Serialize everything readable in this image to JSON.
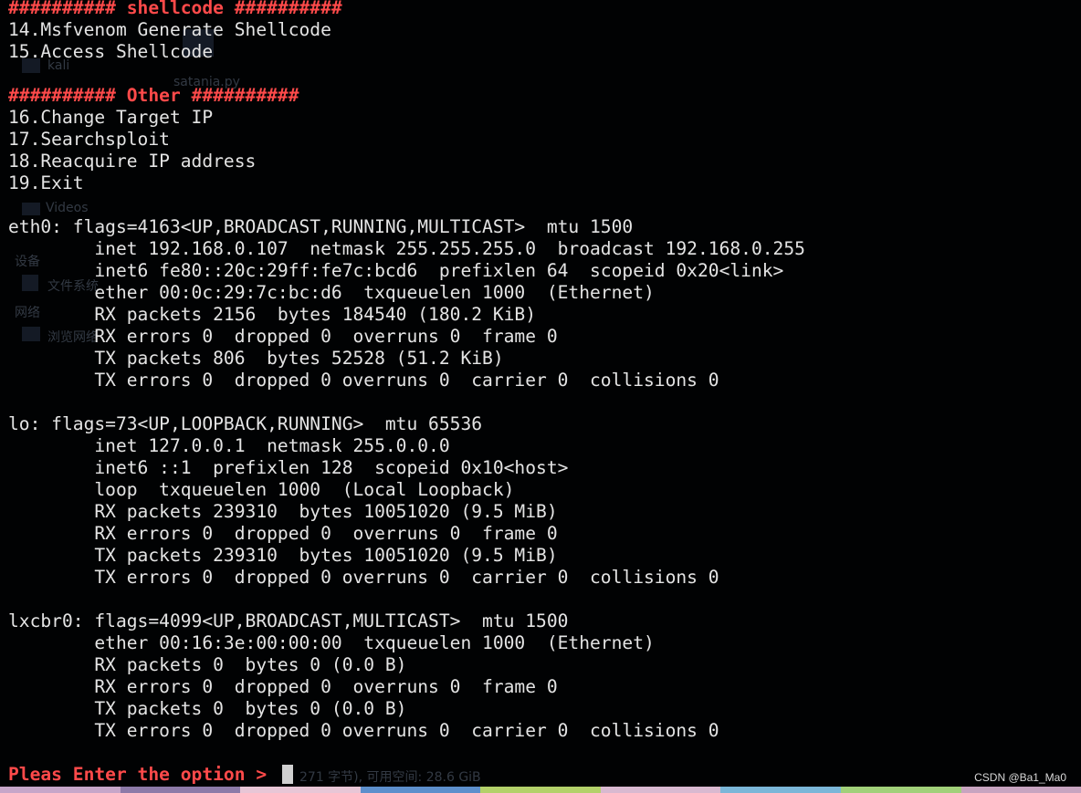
{
  "terminal": {
    "menu": {
      "shellcode_header": "########## shellcode ##########",
      "item_14": "14.Msfvenom Generate Shellcode",
      "item_15": "15.Access Shellcode",
      "other_header": "########## Other ##########",
      "item_16": "16.Change Target IP",
      "item_17": "17.Searchsploit",
      "item_18": "18.Reacquire IP address",
      "item_19": "19.Exit"
    },
    "eth0": {
      "l1": "eth0: flags=4163<UP,BROADCAST,RUNNING,MULTICAST>  mtu 1500",
      "l2": "        inet 192.168.0.107  netmask 255.255.255.0  broadcast 192.168.0.255",
      "l3": "        inet6 fe80::20c:29ff:fe7c:bcd6  prefixlen 64  scopeid 0x20<link>",
      "l4": "        ether 00:0c:29:7c:bc:d6  txqueuelen 1000  (Ethernet)",
      "l5": "        RX packets 2156  bytes 184540 (180.2 KiB)",
      "l6": "        RX errors 0  dropped 0  overruns 0  frame 0",
      "l7": "        TX packets 806  bytes 52528 (51.2 KiB)",
      "l8": "        TX errors 0  dropped 0 overruns 0  carrier 0  collisions 0"
    },
    "lo": {
      "l1": "lo: flags=73<UP,LOOPBACK,RUNNING>  mtu 65536",
      "l2": "        inet 127.0.0.1  netmask 255.0.0.0",
      "l3": "        inet6 ::1  prefixlen 128  scopeid 0x10<host>",
      "l4": "        loop  txqueuelen 1000  (Local Loopback)",
      "l5": "        RX packets 239310  bytes 10051020 (9.5 MiB)",
      "l6": "        RX errors 0  dropped 0  overruns 0  frame 0",
      "l7": "        TX packets 239310  bytes 10051020 (9.5 MiB)",
      "l8": "        TX errors 0  dropped 0 overruns 0  carrier 0  collisions 0"
    },
    "lxcbr0": {
      "l1": "lxcbr0: flags=4099<UP,BROADCAST,MULTICAST>  mtu 1500",
      "l2": "        ether 00:16:3e:00:00:00  txqueuelen 1000  (Ethernet)",
      "l3": "        RX packets 0  bytes 0 (0.0 B)",
      "l4": "        RX errors 0  dropped 0  overruns 0  frame 0",
      "l5": "        TX packets 0  bytes 0 (0.0 B)",
      "l6": "        TX errors 0  dropped 0 overruns 0  carrier 0  collisions 0"
    },
    "prompt": "Pleas Enter the option > "
  },
  "background_ghost": {
    "kali": "kali",
    "satania": "satania.py",
    "videos": "Videos",
    "devices": "设备",
    "filesystem": "文件系统",
    "network": "网络",
    "browse_network": "浏览网络",
    "status_bar": "271 字节), 可用空间: 28.6 GiB"
  },
  "watermark": "CSDN @Ba1_Ma0",
  "colors": {
    "background": "#010203",
    "text": "#e4e4e4",
    "accent_red": "#ff4a4a",
    "cursor": "#d0d0d0"
  }
}
